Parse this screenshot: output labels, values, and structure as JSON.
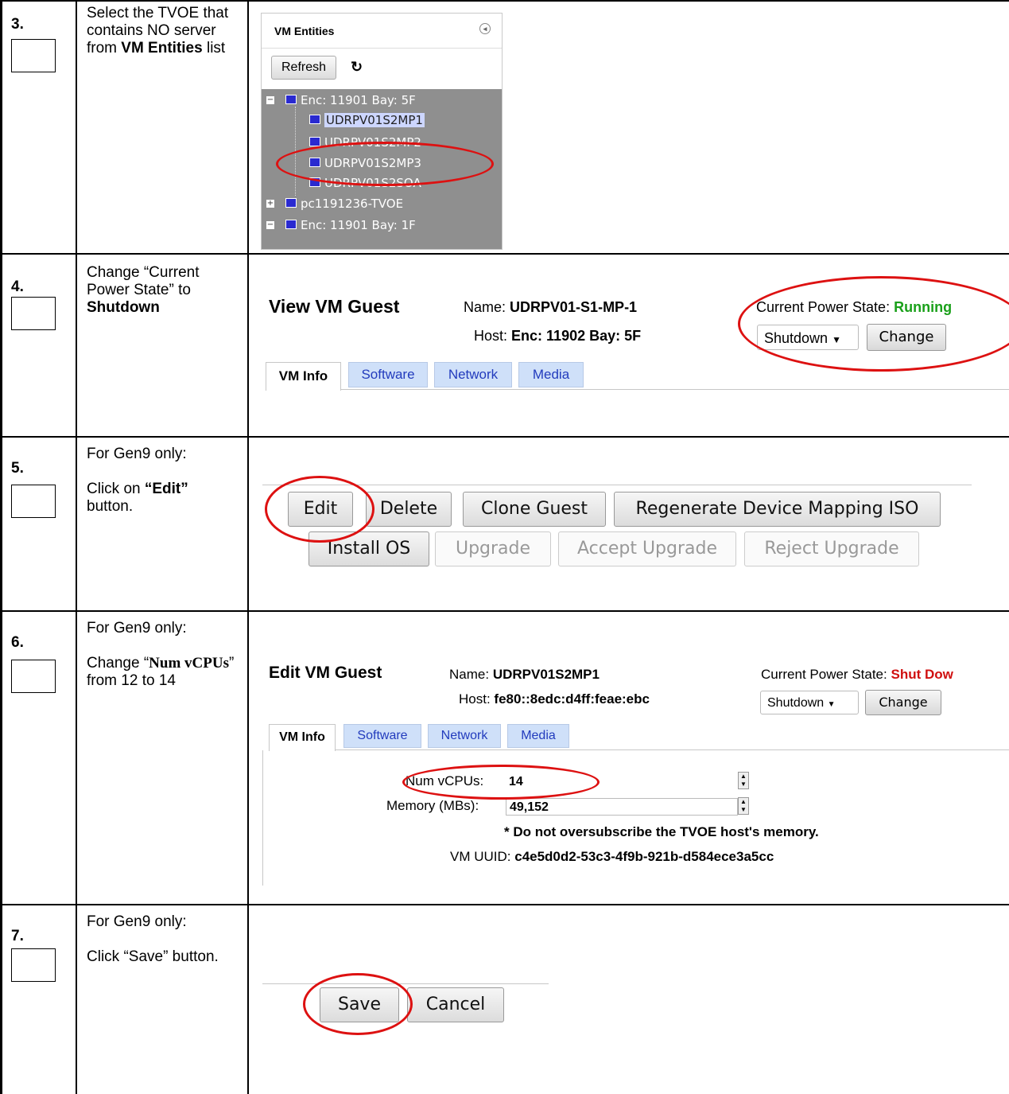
{
  "steps": [
    {
      "num": "3.",
      "text_pre": "Select the TVOE that contains NO server from ",
      "bold1": "VM Entities",
      "text_post": " list"
    },
    {
      "num": "4.",
      "text_pre": "Change “Current Power State” to ",
      "bold1": "Shutdown"
    },
    {
      "num": "5.",
      "line1": "For Gen9 only:",
      "text_pre": "Click on ",
      "bold1": "“Edit”",
      "text_post": " button."
    },
    {
      "num": "6.",
      "line1": "For Gen9 only:",
      "text_pre": "Change “",
      "bold1": "Num vCPUs",
      "text_post": "” from 12 to 14"
    },
    {
      "num": "7.",
      "line1": "For Gen9 only:",
      "text_pre": "Click “Save” button."
    }
  ],
  "entities": {
    "title": "VM Entities",
    "refresh_label": "Refresh",
    "sync_glyph": "↻",
    "collapse_glyph": "◂",
    "items": [
      "Enc: 11901 Bay: 5F",
      "UDRPV01S2MP1",
      "UDRPV01S2MP2",
      "UDRPV01S2MP3",
      "UDRPV01S2SOA",
      "pc1191236-TVOE",
      "Enc: 11901 Bay: 1F"
    ],
    "toggles": [
      "−",
      "+",
      "−"
    ]
  },
  "view_guest": {
    "title": "View VM Guest",
    "name_label": "Name:",
    "name_value": "UDRPV01-S1-MP-1",
    "host_label": "Host:",
    "host_value": "Enc: 11902 Bay: 5F",
    "power_label": "Current Power State:",
    "power_value": "Running",
    "select_value": "Shutdown",
    "change_label": "Change",
    "tabs": [
      "VM Info",
      "Software",
      "Network",
      "Media"
    ]
  },
  "actions": {
    "row1": [
      "Edit",
      "Delete",
      "Clone Guest",
      "Regenerate Device Mapping ISO"
    ],
    "row2": [
      "Install OS",
      "Upgrade",
      "Accept Upgrade",
      "Reject Upgrade"
    ]
  },
  "edit_guest": {
    "title": "Edit VM Guest",
    "name_label": "Name:",
    "name_value": "UDRPV01S2MP1",
    "host_label": "Host:",
    "host_value": "fe80::8edc:d4ff:feae:ebc",
    "power_label": "Current Power State:",
    "power_value": "Shut Dow",
    "select_value": "Shutdown",
    "change_label": "Change",
    "tabs": [
      "VM Info",
      "Software",
      "Network",
      "Media"
    ],
    "vcpus_label": "Num vCPUs:",
    "vcpus_value": "14",
    "memory_label": "Memory (MBs):",
    "memory_value": "49,152",
    "warning": "* Do not oversubscribe the TVOE host's memory.",
    "uuid_label": "VM UUID:",
    "uuid_value": "c4e5d0d2-53c3-4f9b-921b-d584ece3a5cc"
  },
  "save_bar": {
    "save_label": "Save",
    "cancel_label": "Cancel"
  },
  "colors": {
    "annotation": "#dd1111",
    "running": "#1aa01a",
    "shutdown": "#d01010",
    "tab": "#cfe0f9"
  }
}
